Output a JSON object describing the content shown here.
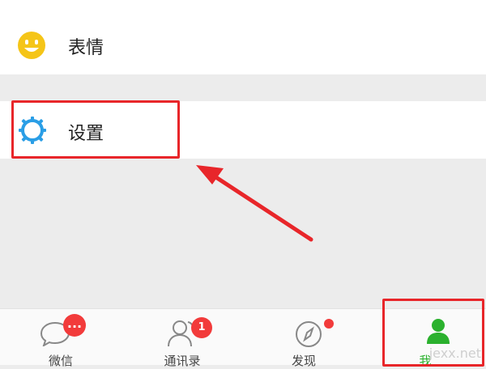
{
  "menu": {
    "emoji_label": "表情",
    "settings_label": "设置"
  },
  "tabs": [
    {
      "label": "微信",
      "badge": "...",
      "icon": "chat-bubble-icon",
      "active": false
    },
    {
      "label": "通讯录",
      "badge": "1",
      "icon": "contacts-icon",
      "active": false
    },
    {
      "label": "发现",
      "badge": "",
      "icon": "compass-icon",
      "active": false
    },
    {
      "label": "我",
      "badge": "",
      "icon": "person-icon",
      "active": true
    }
  ],
  "watermark": "jexx.net",
  "colors": {
    "highlight": "#e8262a",
    "active_tab": "#2bb12e",
    "settings_icon": "#2a9ee6",
    "emoji_icon": "#f5c518",
    "badge": "#f23b3b"
  }
}
